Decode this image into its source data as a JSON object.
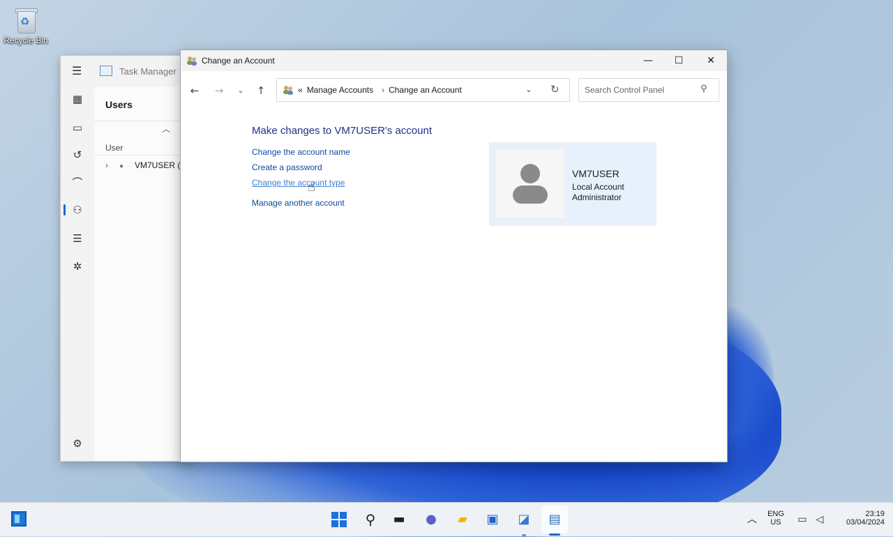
{
  "desktop": {
    "recycle_bin_label": "Recycle Bin"
  },
  "task_manager": {
    "title": "Task Manager",
    "section_title": "Users",
    "column_header": "User",
    "user_row": "VM7USER (3"
  },
  "control_panel": {
    "window_title": "Change an Account",
    "breadcrumb": {
      "overflow": "«",
      "items": [
        "Manage Accounts",
        "Change an Account"
      ]
    },
    "search_placeholder": "Search Control Panel",
    "heading": "Make changes to VM7USER's account",
    "links": {
      "change_name": "Change the account name",
      "create_password": "Create a password",
      "change_type": "Change the account type",
      "manage_another": "Manage another account"
    },
    "account": {
      "name": "VM7USER",
      "type": "Local Account",
      "role": "Administrator"
    }
  },
  "taskbar": {
    "language": "ENG",
    "region": "US",
    "time": "23:19",
    "date": "03/04/2024"
  },
  "colors": {
    "link": "#0d4aa0",
    "heading": "#1e3287",
    "card_bg": "#e6f1fb",
    "accent": "#1a6ac9"
  }
}
